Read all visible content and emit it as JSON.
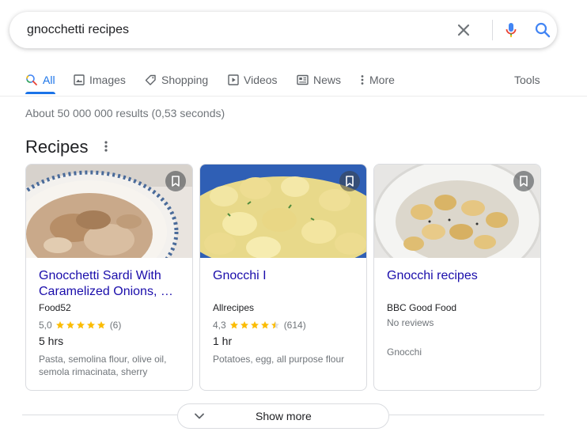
{
  "search": {
    "query": "gnocchetti recipes"
  },
  "tabs": [
    {
      "label": "All",
      "icon": "search-icon",
      "active": true
    },
    {
      "label": "Images",
      "icon": "image-icon"
    },
    {
      "label": "Shopping",
      "icon": "tag-icon"
    },
    {
      "label": "Videos",
      "icon": "play-icon"
    },
    {
      "label": "News",
      "icon": "news-icon"
    },
    {
      "label": "More",
      "icon": "more-vert-icon"
    }
  ],
  "tools_label": "Tools",
  "result_stats": "About 50 000 000 results (0,53 seconds)",
  "recipes": {
    "title": "Recipes",
    "cards": [
      {
        "title": "Gnocchetti Sardi With Caramelized Onions, …",
        "source": "Food52",
        "rating": "5,0",
        "stars": 5,
        "reviews": "(6)",
        "time": "5 hrs",
        "ingredients": "Pasta, semolina flour, olive oil, semola rimacinata, sherry"
      },
      {
        "title": "Gnocchi I",
        "source": "Allrecipes",
        "rating": "4,3",
        "stars": 4.5,
        "reviews": "(614)",
        "time": "1 hr",
        "ingredients": "Potatoes, egg, all purpose flour"
      },
      {
        "title": "Gnocchi recipes",
        "source": "BBC Good Food",
        "no_reviews": "No reviews",
        "tag": "Gnocchi"
      }
    ]
  },
  "show_more_label": "Show more",
  "colors": {
    "link": "#1a0dab",
    "accent": "#1a73e8",
    "star": "#fbbc04",
    "secondary_text": "#70757a"
  }
}
